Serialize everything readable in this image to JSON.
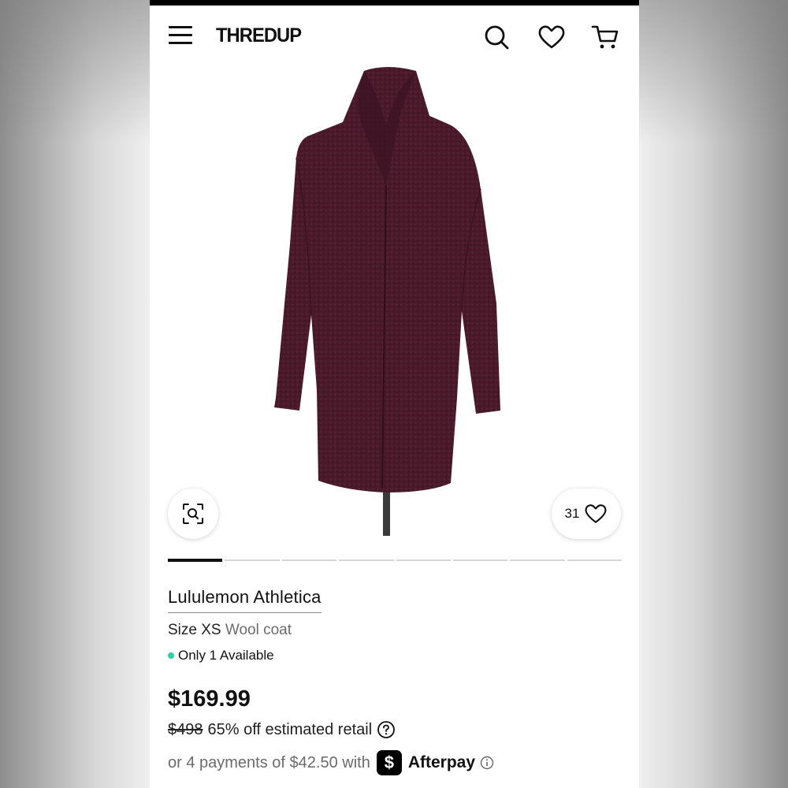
{
  "app": {
    "logo_text": "THREDUP"
  },
  "product": {
    "brand": "Lululemon Athletica",
    "size_label": "Size XS",
    "item_type": "Wool coat",
    "availability": "Only 1 Available",
    "price": "$169.99",
    "retail_price": "$498",
    "discount_text": "65% off estimated retail",
    "favorite_count": "31",
    "image_count": 8,
    "current_image": 1,
    "coat_color": "#4a1a2b"
  },
  "payment": {
    "installments_text": "or 4 payments of $42.50 with",
    "cashapp_glyph": "$",
    "provider": "Afterpay"
  },
  "icons": [
    "menu-icon",
    "search-icon",
    "heart-icon",
    "cart-icon",
    "zoom-icon",
    "help-icon",
    "info-icon"
  ]
}
